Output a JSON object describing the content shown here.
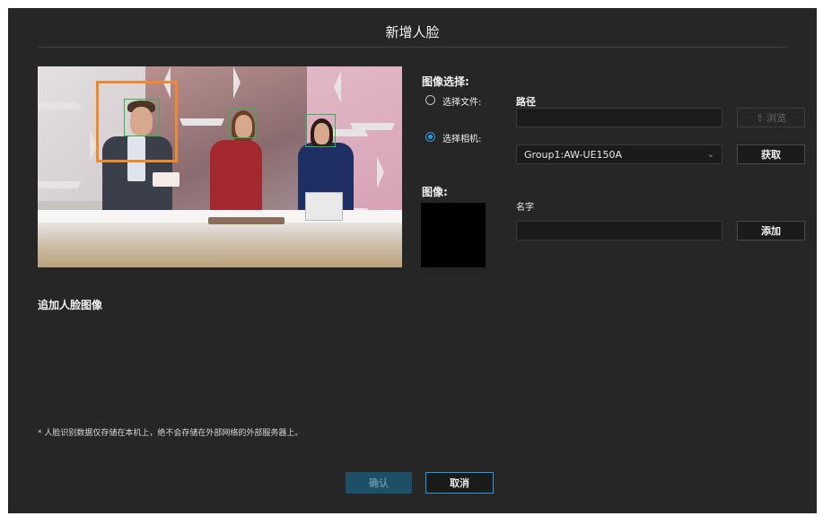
{
  "dialog": {
    "title": "新增人脸"
  },
  "image_selection": {
    "heading": "图像选择:",
    "option_file_label": "选择文件:",
    "option_camera_label": "选择相机:",
    "selected_option": "camera",
    "path_label": "路径",
    "path_value": "",
    "browse_icon": "upload-icon",
    "browse_label": "浏览",
    "camera_select_value": "Group1:AW-UE150A",
    "fetch_label": "获取"
  },
  "image_section": {
    "heading": "图像:",
    "name_label": "名字",
    "name_value": "",
    "add_label": "添加"
  },
  "preview": {
    "faces_detected": 3,
    "selected_face_index": 0,
    "face_box_color": "#2fb84a",
    "selected_box_color": "#ef8a2c"
  },
  "append_section": {
    "heading": "追加人脸图像"
  },
  "footer": {
    "note": "* 人脸识别数据仅存储在本机上，绝不会存储在外部网络的外部服务器上。",
    "confirm_label": "确认",
    "cancel_label": "取消"
  },
  "colors": {
    "accent": "#1f9ee8",
    "background": "#262626"
  }
}
